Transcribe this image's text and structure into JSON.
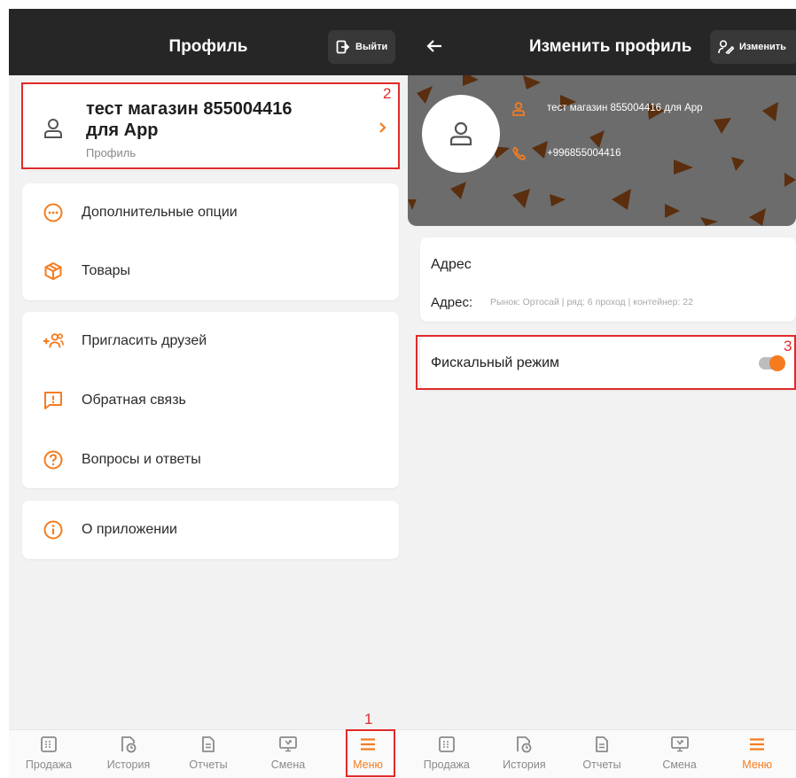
{
  "annotations": {
    "one": "1",
    "two": "2",
    "three": "3"
  },
  "colors": {
    "accent": "#f57c1f",
    "header": "#262626",
    "annotation": "#e12a2a"
  },
  "left": {
    "header": {
      "title": "Профиль",
      "logout_label": "Выйти"
    },
    "profile_card": {
      "name_line1": "тест магазин 855004416",
      "name_line2": "для App",
      "subtitle": "Профиль"
    },
    "group1": [
      {
        "label": "Дополнительные опции",
        "icon": "more-options-icon"
      },
      {
        "label": "Товары",
        "icon": "box-icon"
      }
    ],
    "group2": [
      {
        "label": "Пригласить друзей",
        "icon": "add-friends-icon"
      },
      {
        "label": "Обратная связь",
        "icon": "feedback-icon"
      },
      {
        "label": "Вопросы и ответы",
        "icon": "help-icon"
      }
    ],
    "group3": [
      {
        "label": "О приложении",
        "icon": "info-icon"
      }
    ]
  },
  "right": {
    "header": {
      "title": "Изменить профиль",
      "edit_label": "Изменить"
    },
    "profile": {
      "name": "тест магазин 855004416 для App",
      "phone": "+996855004416"
    },
    "address_card": {
      "title": "Адрес",
      "label": "Адрес:",
      "value": "Рынок: Ортосай | ряд: 6 проход | контейнер: 22"
    },
    "fiscal": {
      "label": "Фискальный режим",
      "enabled": true
    }
  },
  "nav": [
    {
      "label": "Продажа",
      "icon": "cash-register-icon"
    },
    {
      "label": "История",
      "icon": "history-icon"
    },
    {
      "label": "Отчеты",
      "icon": "report-icon"
    },
    {
      "label": "Смена",
      "icon": "shift-icon"
    },
    {
      "label": "Меню",
      "icon": "menu-icon",
      "active": true
    }
  ]
}
